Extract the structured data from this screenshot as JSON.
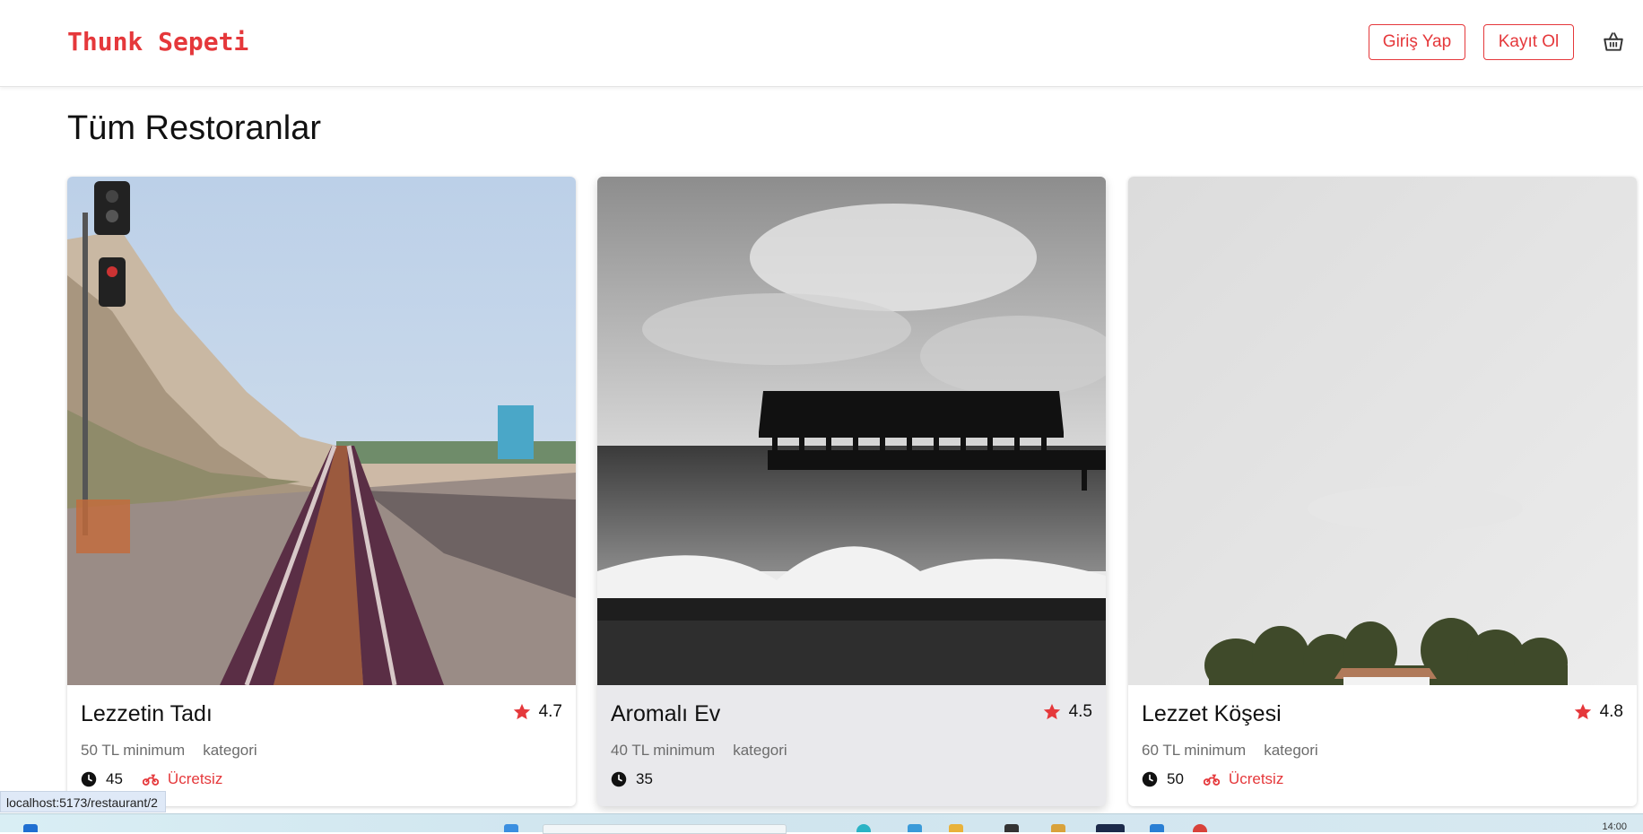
{
  "header": {
    "brand": "Thunk Sepeti",
    "login_label": "Giriş Yap",
    "signup_label": "Kayıt Ol",
    "cart_icon": "basket-icon"
  },
  "main": {
    "title": "Tüm Restoranlar",
    "restaurants": [
      {
        "name": "Lezzetin Tadı",
        "rating": "4.7",
        "min_order": "50 TL minimum",
        "category": "kategori",
        "delivery_time": "45",
        "delivery_fee": "Ücretsiz"
      },
      {
        "name": "Aromalı Ev",
        "rating": "4.5",
        "min_order": "40 TL minimum",
        "category": "kategori",
        "delivery_time": "35",
        "delivery_fee": ""
      },
      {
        "name": "Lezzet Köşesi",
        "rating": "4.8",
        "min_order": "60 TL minimum",
        "category": "kategori",
        "delivery_time": "50",
        "delivery_fee": "Ücretsiz"
      }
    ]
  },
  "status_bar": {
    "url": "localhost:5173/restaurant/2"
  },
  "taskbar": {
    "time": "14:00"
  },
  "colors": {
    "accent": "#e5383b",
    "muted_text": "#6c6c6c"
  }
}
